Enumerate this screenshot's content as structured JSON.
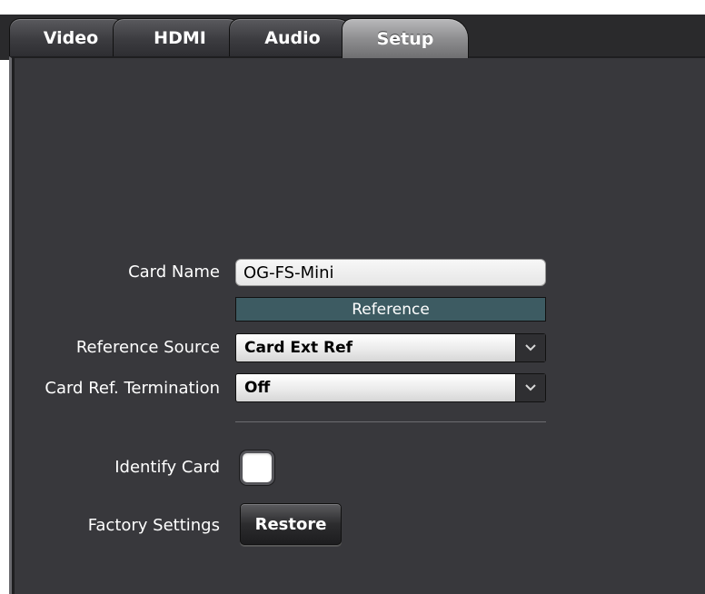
{
  "tabs": [
    {
      "label": "Video",
      "active": false
    },
    {
      "label": "HDMI",
      "active": false
    },
    {
      "label": "Audio",
      "active": false
    },
    {
      "label": "Setup",
      "active": true
    }
  ],
  "setup": {
    "card_name": {
      "label": "Card Name",
      "value": "OG-FS-Mini"
    },
    "reference_header": "Reference",
    "reference_source": {
      "label": "Reference Source",
      "value": "Card Ext Ref"
    },
    "card_ref_termination": {
      "label": "Card Ref. Termination",
      "value": "Off"
    },
    "identify_card": {
      "label": "Identify Card",
      "checked": false
    },
    "factory_settings": {
      "label": "Factory Settings",
      "button_label": "Restore"
    }
  },
  "icons": {
    "select_arrow": "chevron-down-icon"
  },
  "colors": {
    "panel_bg": "#38383c",
    "reference_header_bg": "#3d5b62",
    "active_tab": "#9a9a9c"
  }
}
